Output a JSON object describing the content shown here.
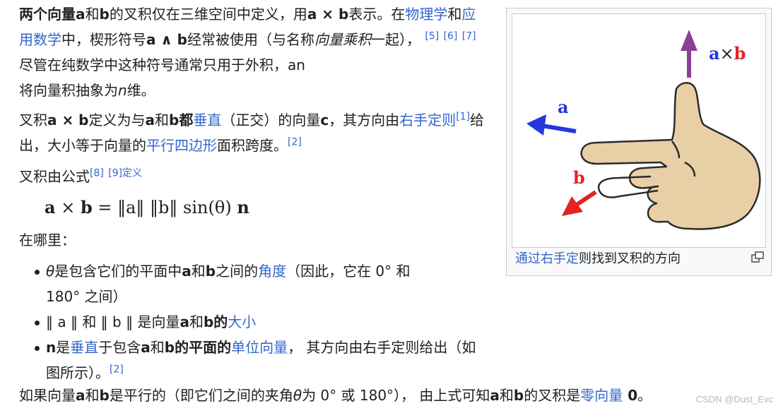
{
  "para1": {
    "s1": "两个向量",
    "s2": "a",
    "s3": "和",
    "s4": "b",
    "s5": "的叉积仅在三维空间中定义，用",
    "s6": "a × b",
    "s7": "表示。在",
    "link_physics": "物理学",
    "s8": "和",
    "link_applied_math": "应用数学",
    "s9": "中，楔形符号",
    "s10": "a ∧ b",
    "s11": "经常被使用（与名称",
    "s12": "向量乘积",
    "s13": "一起），",
    "cite1": "[5]",
    "cite2": "[6]",
    "cite3": "[7]",
    "s14": "尽管在纯数学中这种符号通常只用于外积，an",
    "s15": "将向量积抽象为",
    "s16": "n",
    "s17": "维。"
  },
  "para2": {
    "s1": "叉积",
    "s2": "a × b",
    "s3": "定义为与",
    "s4": "a",
    "s5": "和",
    "s6": "b都",
    "link_perpendicular": "垂直",
    "s7": "（正交）的向量",
    "s8": "c",
    "s9": "，其方向由",
    "link_right_hand": "右手定则",
    "cite1": "[1]",
    "s10": "给出，大小等于向量的",
    "link_parallelogram": "平行四边形",
    "s11": "面积跨度。",
    "cite2": "[2]"
  },
  "para3": {
    "s1": "叉积由公式",
    "cite1": "[8]",
    "cite2": "[9]",
    "link_def": "定义"
  },
  "formula": {
    "a": "a",
    "times": " × ",
    "b": "b",
    "eq": " = ",
    "na": "‖a‖",
    "nb": "‖b‖",
    "sin": " sin(θ) ",
    "n": "n"
  },
  "para4": {
    "s1": "在哪里："
  },
  "bullets": {
    "b1": {
      "s1": "θ",
      "s2": "是包含它们的平面中",
      "s3": "a",
      "s4": "和",
      "s5": "b",
      "s6": "之间的",
      "link_angle": "角度",
      "s7": "（因此，它在 0° 和",
      "s8": "180° 之间）"
    },
    "b2": {
      "s1": "‖ a ‖ 和 ‖ b ‖ 是向量",
      "s2": "a",
      "s3": "和",
      "s4": "b的",
      "link_magnitude": "大小"
    },
    "b3": {
      "s1": "n",
      "s2": "是",
      "link_perpendicular": "垂直",
      "s3": "于包含",
      "s4": "a",
      "s5": "和",
      "s6": "b的平面的",
      "link_unit_vector": "单位向量",
      "s7": "， 其方向由右手定则给出（如图所示）。",
      "cite1": "[2]"
    }
  },
  "para5": {
    "s1": "如果向量",
    "s2": "a",
    "s3": "和",
    "s4": "b",
    "s5": "是平行的（即它们之间的夹角",
    "s6": "θ",
    "s7": "为 0° 或 180°）， 由上式可知",
    "s8": "a",
    "s9": "和",
    "s10": "b",
    "s11": "的叉积是",
    "link_zero_vector": "零向量",
    "s12": " 0",
    "s13": "。"
  },
  "figure": {
    "label_a": "a",
    "label_b": "b",
    "label_axb_a": "a",
    "label_axb_times": "×",
    "label_axb_b": "b",
    "caption_link": "通过右手定",
    "caption_rest": "则找到叉积的方向"
  },
  "watermark": "CSDN @Dust_Evc",
  "colors": {
    "link": "#3366cc",
    "text": "#202122",
    "arrow_a": "#2437e0",
    "arrow_b": "#e02424",
    "arrow_axb": "#8a3f9c",
    "skin": "#e8cfa6",
    "skin_stroke": "#2b2b2b"
  }
}
